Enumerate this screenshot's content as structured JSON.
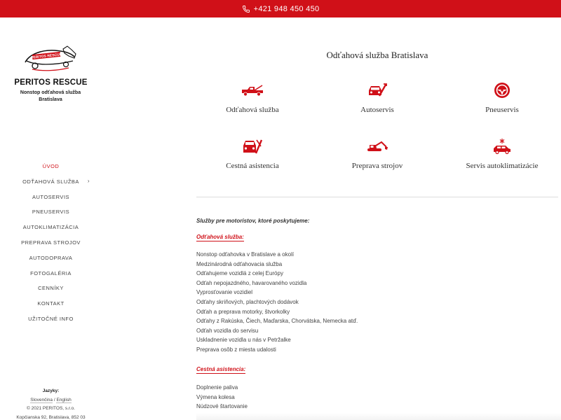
{
  "topbar": {
    "phone": "+421 948 450 450",
    "phone_icon": "phone-icon"
  },
  "brand": {
    "logo_text": "PERITOS RESCUE",
    "name": "PERITOS RESCUE",
    "tagline": "Nonstop odťahová služba Bratislava"
  },
  "nav": {
    "items": [
      {
        "label": "ÚVOD"
      },
      {
        "label": "ODŤAHOVÁ SLUŽBA"
      },
      {
        "label": "AUTOSERVIS"
      },
      {
        "label": "PNEUSERVIS"
      },
      {
        "label": "AUTOKLIMATIZÁCIA"
      },
      {
        "label": "PREPRAVA STROJOV"
      },
      {
        "label": "AUTODOPRAVA"
      },
      {
        "label": "FOTOGALÉRIA"
      },
      {
        "label": "CENNÍKY"
      },
      {
        "label": "KONTAKT"
      },
      {
        "label": "UŽITOČNÉ INFO"
      }
    ]
  },
  "footer": {
    "languages_title": "Jazyky:",
    "lang_sk": "Slovenčina",
    "lang_sep": "/",
    "lang_en": "English",
    "copyright": "© 2021 PERITOS, s.r.o.",
    "address": "Kopčianska 92, Bratislava, 852 03"
  },
  "main": {
    "title": "Odťahová služba Bratislava",
    "services": [
      {
        "label": "Odťahová služba",
        "icon": "tow-truck-icon"
      },
      {
        "label": "Autoservis",
        "icon": "car-wrench-icon"
      },
      {
        "label": "Pneuservis",
        "icon": "steering-wheel-icon"
      },
      {
        "label": "Cestná asistencia",
        "icon": "road-assist-icon"
      },
      {
        "label": "Preprava strojov",
        "icon": "excavator-icon"
      },
      {
        "label": "Servis autoklimatizácie",
        "icon": "car-ac-icon"
      }
    ],
    "intro": "Služby pre motoristov, ktoré poskytujeme:",
    "sections": [
      {
        "heading": "Odťahová služba:",
        "items": [
          "Nonstop odťahovka v Bratislave a okolí",
          "Medzinárodná odťahovacia služba",
          "Odťahujeme vozidlá z celej Európy",
          "Odťah nepojazdného, havarovaného vozidla",
          "Vyprosťovanie vozidiel",
          "Odťahy skriňových, plachtových dodávok",
          "Odťah a preprava motorky, štvorkolky",
          "Odťahy z Rakúska, Čiech, Maďarska, Chorvátska, Nemecka atď.",
          "Odťah vozidla do servisu",
          "Uskladnenie vozidla u nás v Petržalke",
          "Preprava osôb z miesta udalosti"
        ]
      },
      {
        "heading": "Cestná asistencia:",
        "items": [
          "Doplnenie paliva",
          "Výmena kolesa",
          "Núdzové štartovanie"
        ]
      }
    ]
  },
  "colors": {
    "accent": "#d01018",
    "text": "#333333"
  }
}
